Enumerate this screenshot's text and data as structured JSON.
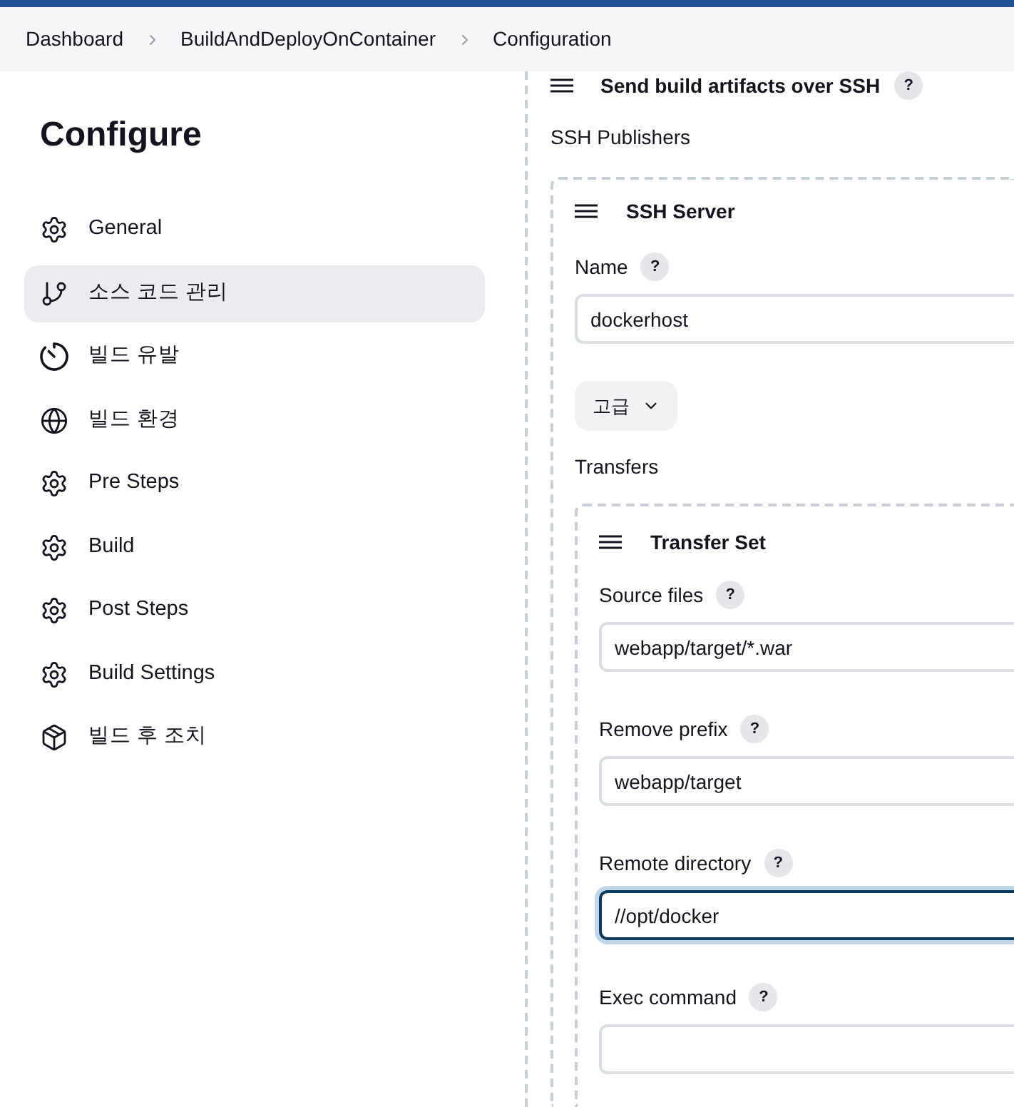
{
  "breadcrumbs": [
    {
      "label": "Dashboard"
    },
    {
      "label": "BuildAndDeployOnContainer"
    },
    {
      "label": "Configuration"
    }
  ],
  "sidebar": {
    "title": "Configure",
    "items": [
      {
        "label": "General",
        "kind": "settings",
        "selected": false
      },
      {
        "label": "소스 코드 관리",
        "kind": "source",
        "selected": true
      },
      {
        "label": "빌드 유발",
        "kind": "trigger",
        "selected": false
      },
      {
        "label": "빌드 환경",
        "kind": "environment",
        "selected": false
      },
      {
        "label": "Pre Steps",
        "kind": "settings",
        "selected": false
      },
      {
        "label": "Build",
        "kind": "settings",
        "selected": false
      },
      {
        "label": "Post Steps",
        "kind": "settings",
        "selected": false
      },
      {
        "label": "Build Settings",
        "kind": "settings",
        "selected": false
      },
      {
        "label": "빌드 후 조치",
        "kind": "post_build",
        "selected": false
      }
    ]
  },
  "section": {
    "title": "Send build artifacts over SSH",
    "help": "?",
    "subtitle": "SSH Publishers",
    "server": {
      "title": "SSH Server",
      "fields": [
        {
          "label": "Name",
          "help": "?",
          "value": "dockerhost",
          "focused": false
        }
      ],
      "advanced_button": "고급",
      "transfers_label": "Transfers",
      "transfer_set": {
        "title": "Transfer Set",
        "fields": [
          {
            "label": "Source files",
            "help": "?",
            "value": "webapp/target/*.war",
            "focused": false
          },
          {
            "label": "Remove prefix",
            "help": "?",
            "value": "webapp/target",
            "focused": false
          },
          {
            "label": "Remote directory",
            "help": "?",
            "value": "//opt/docker",
            "focused": true
          },
          {
            "label": "Exec command",
            "help": "?",
            "focused": false
          }
        ]
      }
    }
  }
}
